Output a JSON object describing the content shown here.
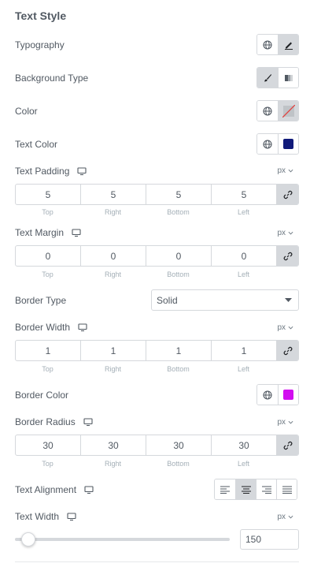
{
  "section_title": "Text Style",
  "typography": {
    "label": "Typography",
    "icons": [
      "globe-icon",
      "pencil-icon"
    ]
  },
  "background_type": {
    "label": "Background Type",
    "icons": [
      "brush-icon",
      "gradient-icon"
    ]
  },
  "color": {
    "label": "Color",
    "value_swatch": "none"
  },
  "text_color": {
    "label": "Text Color",
    "swatch": "#101a7a"
  },
  "text_padding": {
    "label": "Text Padding",
    "unit": "px",
    "top": "5",
    "right": "5",
    "bottom": "5",
    "left": "5"
  },
  "text_margin": {
    "label": "Text Margin",
    "unit": "px",
    "top": "0",
    "right": "0",
    "bottom": "0",
    "left": "0"
  },
  "dim_labels": {
    "top": "Top",
    "right": "Right",
    "bottom": "Bottom",
    "left": "Left"
  },
  "border_type": {
    "label": "Border Type",
    "value": "Solid"
  },
  "border_width": {
    "label": "Border Width",
    "unit": "px",
    "top": "1",
    "right": "1",
    "bottom": "1",
    "left": "1"
  },
  "border_color": {
    "label": "Border Color",
    "swatch": "#d20ef0"
  },
  "border_radius": {
    "label": "Border Radius",
    "unit": "px",
    "top": "30",
    "right": "30",
    "bottom": "30",
    "left": "30"
  },
  "text_alignment": {
    "label": "Text Alignment",
    "selected": "center",
    "options": [
      "left",
      "center",
      "right",
      "justify"
    ]
  },
  "text_width": {
    "label": "Text Width",
    "unit": "px",
    "value": "150",
    "slider_level": 0.03
  },
  "colors": {
    "active_bg": "#d5d8dc",
    "border": "#d5d8dc",
    "text": "#515962"
  }
}
